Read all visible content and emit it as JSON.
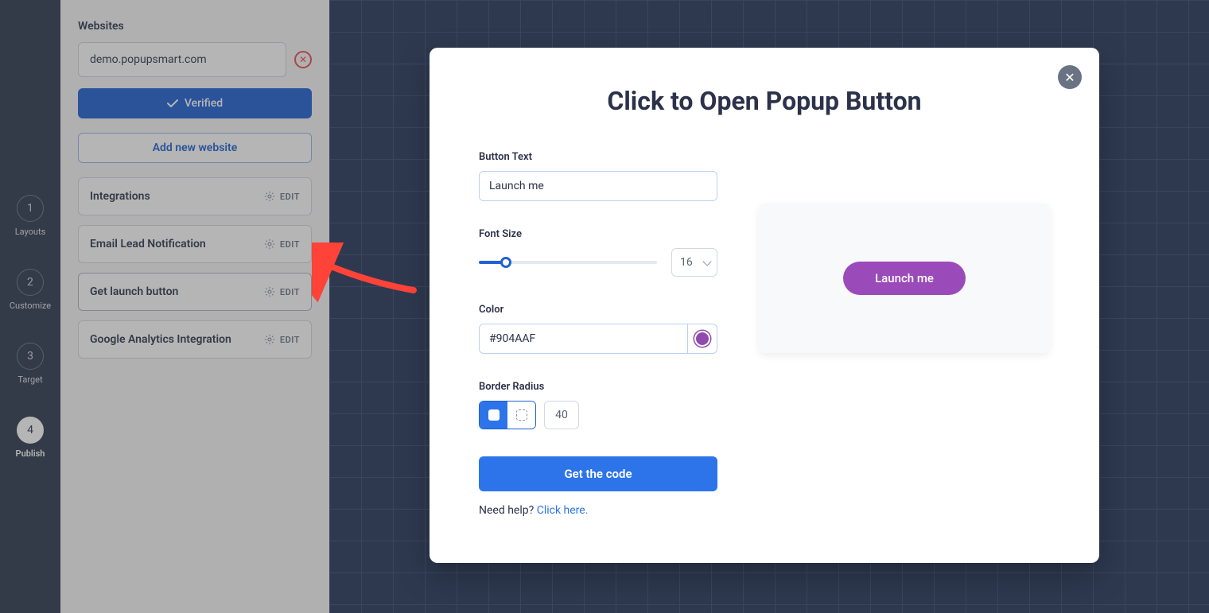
{
  "rail": {
    "steps": [
      {
        "num": "1",
        "label": "Layouts"
      },
      {
        "num": "2",
        "label": "Customize"
      },
      {
        "num": "3",
        "label": "Target"
      },
      {
        "num": "4",
        "label": "Publish"
      }
    ]
  },
  "sidebar": {
    "websites_heading": "Websites",
    "website_value": "demo.popupsmart.com",
    "verified_label": "Verified",
    "add_website_label": "Add new website",
    "edit_label": "EDIT",
    "items": [
      {
        "label": "Integrations"
      },
      {
        "label": "Email Lead Notification"
      },
      {
        "label": "Get launch button"
      },
      {
        "label": "Google Analytics Integration"
      }
    ]
  },
  "modal": {
    "title": "Click to Open Popup Button",
    "labels": {
      "button_text": "Button Text",
      "font_size": "Font Size",
      "color": "Color",
      "border_radius": "Border Radius"
    },
    "button_text_value": "Launch me",
    "font_size_value": "16",
    "color_value": "#904AAF",
    "border_radius_value": "40",
    "get_code_label": "Get the code",
    "help_prefix": "Need help? ",
    "help_link": "Click here.",
    "preview_button_label": "Launch me"
  }
}
